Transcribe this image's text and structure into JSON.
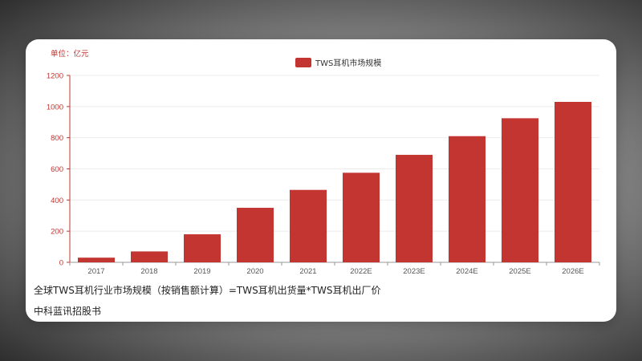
{
  "caption": "全球TWS耳机行业市场规模（按销售额计算）=TWS耳机出货量*TWS耳机出厂价",
  "source": "中科蓝讯招股书",
  "chart_data": {
    "type": "bar",
    "unit_label": "单位：亿元",
    "categories": [
      "2017",
      "2018",
      "2019",
      "2020",
      "2021",
      "2022E",
      "2023E",
      "2024E",
      "2025E",
      "2026E"
    ],
    "series": [
      {
        "name": "TWS耳机市场规模",
        "values": [
          30,
          70,
          180,
          350,
          465,
          575,
          690,
          810,
          925,
          1030
        ],
        "color": "#c23531"
      }
    ],
    "ylim": [
      0,
      1200
    ],
    "yticks": [
      0,
      200,
      400,
      600,
      800,
      1000,
      1200
    ],
    "grid": true,
    "legend": "top-center",
    "axis_color": "#c23531"
  }
}
